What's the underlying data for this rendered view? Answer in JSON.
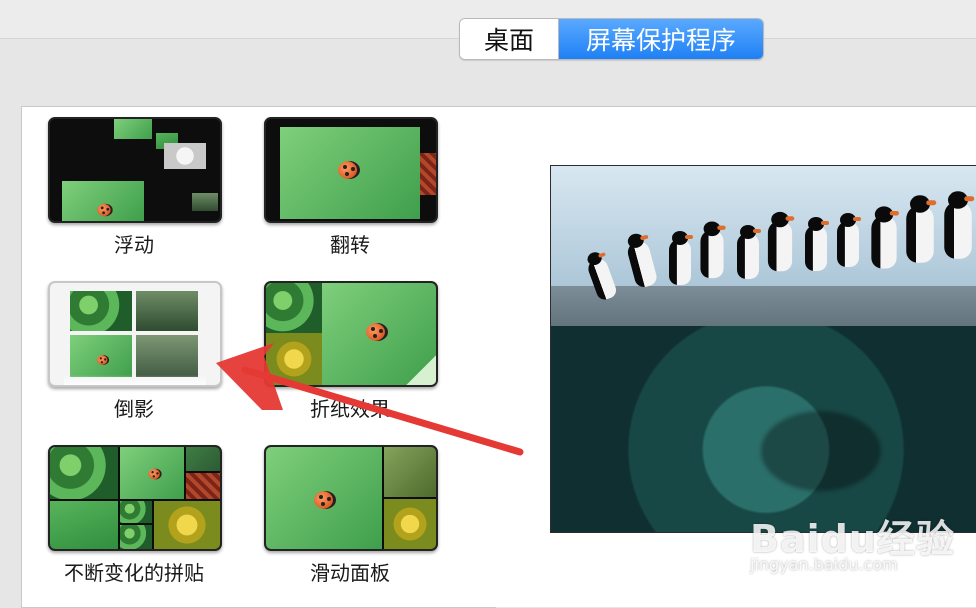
{
  "segmented": {
    "tab_desktop": "桌面",
    "tab_screensaver": "屏幕保护程序"
  },
  "screensavers": [
    {
      "label": "浮动"
    },
    {
      "label": "翻转"
    },
    {
      "label": "倒影"
    },
    {
      "label": "折纸效果"
    },
    {
      "label": "不断变化的拼贴"
    },
    {
      "label": "滑动面板"
    }
  ],
  "selected_screensaver": "倒影",
  "watermark": {
    "main": "Baidu经验",
    "sub": "jingyan.baidu.com"
  },
  "colors": {
    "accent_blue": "#1f80f4",
    "arrow_red": "#e53935"
  }
}
